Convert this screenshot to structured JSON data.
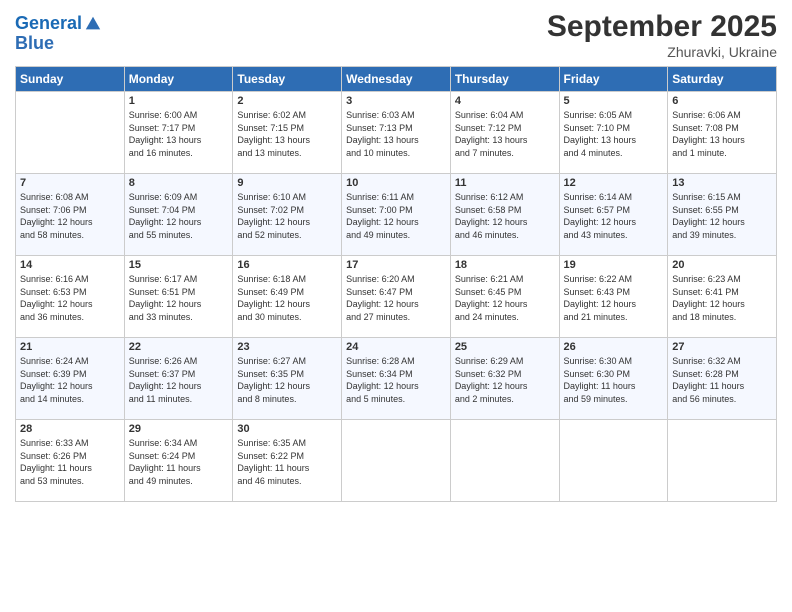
{
  "header": {
    "logo_line1": "General",
    "logo_line2": "Blue",
    "month": "September 2025",
    "location": "Zhuravki, Ukraine"
  },
  "weekdays": [
    "Sunday",
    "Monday",
    "Tuesday",
    "Wednesday",
    "Thursday",
    "Friday",
    "Saturday"
  ],
  "weeks": [
    [
      {
        "day": "",
        "info": ""
      },
      {
        "day": "1",
        "info": "Sunrise: 6:00 AM\nSunset: 7:17 PM\nDaylight: 13 hours\nand 16 minutes."
      },
      {
        "day": "2",
        "info": "Sunrise: 6:02 AM\nSunset: 7:15 PM\nDaylight: 13 hours\nand 13 minutes."
      },
      {
        "day": "3",
        "info": "Sunrise: 6:03 AM\nSunset: 7:13 PM\nDaylight: 13 hours\nand 10 minutes."
      },
      {
        "day": "4",
        "info": "Sunrise: 6:04 AM\nSunset: 7:12 PM\nDaylight: 13 hours\nand 7 minutes."
      },
      {
        "day": "5",
        "info": "Sunrise: 6:05 AM\nSunset: 7:10 PM\nDaylight: 13 hours\nand 4 minutes."
      },
      {
        "day": "6",
        "info": "Sunrise: 6:06 AM\nSunset: 7:08 PM\nDaylight: 13 hours\nand 1 minute."
      }
    ],
    [
      {
        "day": "7",
        "info": "Sunrise: 6:08 AM\nSunset: 7:06 PM\nDaylight: 12 hours\nand 58 minutes."
      },
      {
        "day": "8",
        "info": "Sunrise: 6:09 AM\nSunset: 7:04 PM\nDaylight: 12 hours\nand 55 minutes."
      },
      {
        "day": "9",
        "info": "Sunrise: 6:10 AM\nSunset: 7:02 PM\nDaylight: 12 hours\nand 52 minutes."
      },
      {
        "day": "10",
        "info": "Sunrise: 6:11 AM\nSunset: 7:00 PM\nDaylight: 12 hours\nand 49 minutes."
      },
      {
        "day": "11",
        "info": "Sunrise: 6:12 AM\nSunset: 6:58 PM\nDaylight: 12 hours\nand 46 minutes."
      },
      {
        "day": "12",
        "info": "Sunrise: 6:14 AM\nSunset: 6:57 PM\nDaylight: 12 hours\nand 43 minutes."
      },
      {
        "day": "13",
        "info": "Sunrise: 6:15 AM\nSunset: 6:55 PM\nDaylight: 12 hours\nand 39 minutes."
      }
    ],
    [
      {
        "day": "14",
        "info": "Sunrise: 6:16 AM\nSunset: 6:53 PM\nDaylight: 12 hours\nand 36 minutes."
      },
      {
        "day": "15",
        "info": "Sunrise: 6:17 AM\nSunset: 6:51 PM\nDaylight: 12 hours\nand 33 minutes."
      },
      {
        "day": "16",
        "info": "Sunrise: 6:18 AM\nSunset: 6:49 PM\nDaylight: 12 hours\nand 30 minutes."
      },
      {
        "day": "17",
        "info": "Sunrise: 6:20 AM\nSunset: 6:47 PM\nDaylight: 12 hours\nand 27 minutes."
      },
      {
        "day": "18",
        "info": "Sunrise: 6:21 AM\nSunset: 6:45 PM\nDaylight: 12 hours\nand 24 minutes."
      },
      {
        "day": "19",
        "info": "Sunrise: 6:22 AM\nSunset: 6:43 PM\nDaylight: 12 hours\nand 21 minutes."
      },
      {
        "day": "20",
        "info": "Sunrise: 6:23 AM\nSunset: 6:41 PM\nDaylight: 12 hours\nand 18 minutes."
      }
    ],
    [
      {
        "day": "21",
        "info": "Sunrise: 6:24 AM\nSunset: 6:39 PM\nDaylight: 12 hours\nand 14 minutes."
      },
      {
        "day": "22",
        "info": "Sunrise: 6:26 AM\nSunset: 6:37 PM\nDaylight: 12 hours\nand 11 minutes."
      },
      {
        "day": "23",
        "info": "Sunrise: 6:27 AM\nSunset: 6:35 PM\nDaylight: 12 hours\nand 8 minutes."
      },
      {
        "day": "24",
        "info": "Sunrise: 6:28 AM\nSunset: 6:34 PM\nDaylight: 12 hours\nand 5 minutes."
      },
      {
        "day": "25",
        "info": "Sunrise: 6:29 AM\nSunset: 6:32 PM\nDaylight: 12 hours\nand 2 minutes."
      },
      {
        "day": "26",
        "info": "Sunrise: 6:30 AM\nSunset: 6:30 PM\nDaylight: 11 hours\nand 59 minutes."
      },
      {
        "day": "27",
        "info": "Sunrise: 6:32 AM\nSunset: 6:28 PM\nDaylight: 11 hours\nand 56 minutes."
      }
    ],
    [
      {
        "day": "28",
        "info": "Sunrise: 6:33 AM\nSunset: 6:26 PM\nDaylight: 11 hours\nand 53 minutes."
      },
      {
        "day": "29",
        "info": "Sunrise: 6:34 AM\nSunset: 6:24 PM\nDaylight: 11 hours\nand 49 minutes."
      },
      {
        "day": "30",
        "info": "Sunrise: 6:35 AM\nSunset: 6:22 PM\nDaylight: 11 hours\nand 46 minutes."
      },
      {
        "day": "",
        "info": ""
      },
      {
        "day": "",
        "info": ""
      },
      {
        "day": "",
        "info": ""
      },
      {
        "day": "",
        "info": ""
      }
    ]
  ]
}
